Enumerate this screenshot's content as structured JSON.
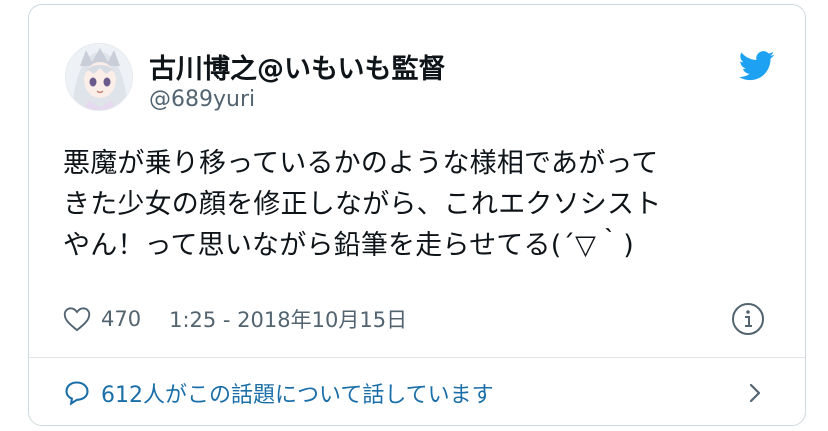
{
  "tweet": {
    "author": {
      "display_name": "古川博之@いもいも監督",
      "handle": "@689yuri",
      "avatar_icon": "anime-avatar-icon"
    },
    "text_lines": [
      "悪魔が乗り移っているかのような様相であがって",
      "きた少女の顔を修正しながら、これエクソシスト",
      "やん！って思いながら鉛筆を走らせてる(´▽｀)"
    ],
    "likes": "470",
    "timestamp": "1:25 - 2018年10月15日",
    "conversation_link": "612人がこの話題について話しています"
  },
  "colors": {
    "twitter_blue": "#1da1f2",
    "link_blue": "#1b6fa8",
    "secondary_text": "#536471",
    "border": "#cfd9de"
  }
}
